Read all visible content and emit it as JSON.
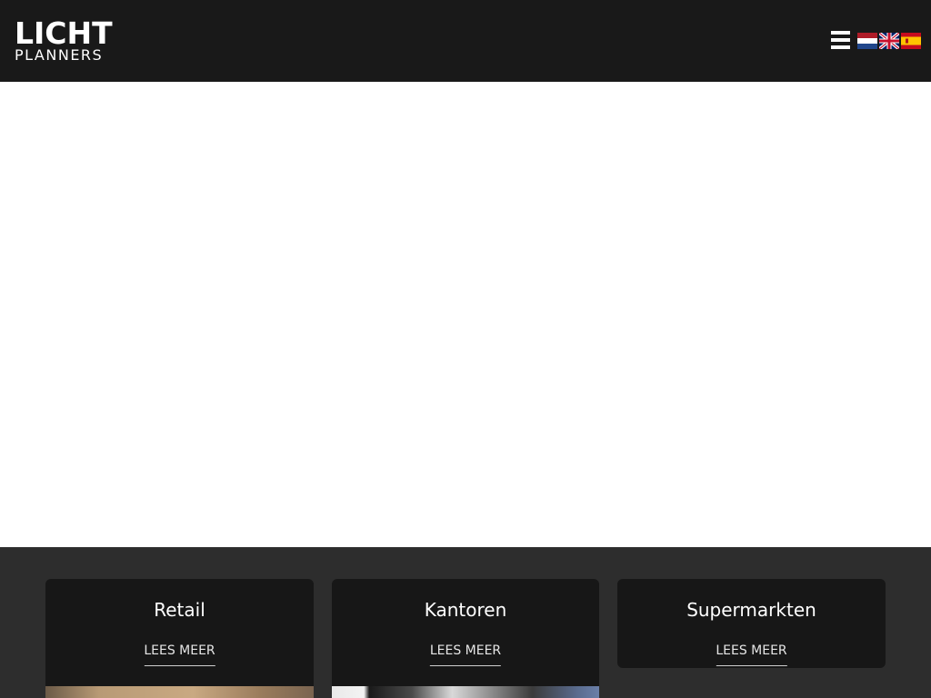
{
  "header": {
    "logo": {
      "line1": "LICHT",
      "line2": "PLANNERS"
    },
    "menu_icon": "hamburger-menu-icon",
    "languages": [
      {
        "code": "nl",
        "icon": "flag-netherlands-icon"
      },
      {
        "code": "en",
        "icon": "flag-united-kingdom-icon"
      },
      {
        "code": "es",
        "icon": "flag-spain-icon"
      }
    ],
    "background": "#191919"
  },
  "sectors": {
    "background": "#2d2d2d",
    "card_background": "#171717",
    "cards": [
      {
        "title": "Retail",
        "link": "LEES MEER"
      },
      {
        "title": "Kantoren",
        "link": "LEES MEER"
      },
      {
        "title": "Supermarkten",
        "link": "LEES MEER"
      }
    ]
  }
}
